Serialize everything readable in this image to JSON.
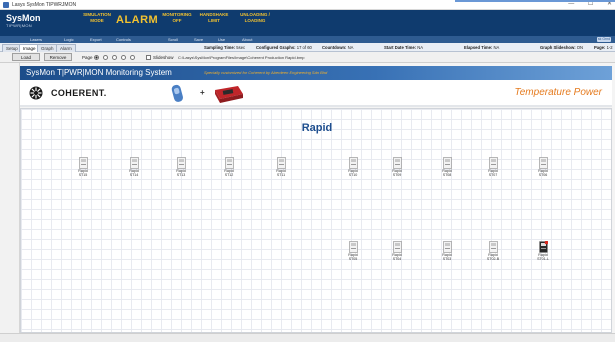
{
  "window": {
    "title": "Lasys SysMon TIPWRJMON",
    "controls": [
      "—",
      "☐",
      "✕"
    ]
  },
  "brand": {
    "name": "SysMon",
    "sub": "TIPWR|MON"
  },
  "ribbon": {
    "simulation": "SIMULATION MODE",
    "alarm": "ALARM",
    "monitoring": "MONITORING OFF",
    "handshake": "HANDSHAKE LIMIT",
    "unloading": "UNLOADING / LOADING"
  },
  "strip": {
    "items": [
      "Lasers",
      "Logic",
      "Export",
      "Controls",
      "Scroll",
      "Save",
      "Use",
      "About"
    ],
    "right": "sk Grnd"
  },
  "tabs": [
    "Setup",
    "Image",
    "Graph",
    "Alarm"
  ],
  "status": {
    "sampling": {
      "label": "Sampling Time:",
      "value": "5sec"
    },
    "graphs": {
      "label": "Configured Graphs:",
      "value": "17 of 60"
    },
    "countdown": {
      "label": "Countdown:",
      "value": "NA"
    },
    "start": {
      "label": "Start Date Time:",
      "value": "NA"
    },
    "elapsed": {
      "label": "Elapsed Time:",
      "value": "NA"
    },
    "slideshow": {
      "label": "Graph Slideshow:",
      "value": "ON"
    },
    "page": {
      "label": "Page:",
      "value": "1-2"
    }
  },
  "toolbar": {
    "load": "Load",
    "remove": "Remove",
    "page_label": "Page",
    "slideshow_label": "Slideshow",
    "path": "C:\\Lasys\\SysMon\\ProgramFiles\\Image\\Coherent Production Rapid.bmp"
  },
  "banner": {
    "title": "SysMon T|PWR|MON Monitoring System",
    "tagline": "Specially customized for Coherent by Aberdeen Engineering Sdn Bhd"
  },
  "logos": {
    "company": "COHERENT.",
    "plus": "+",
    "product_title": "Temperature Power"
  },
  "canvas": {
    "title": "Rapid",
    "devices": [
      {
        "label": "Rapid ST15",
        "alert": false
      },
      {
        "label": "Rapid ST14",
        "alert": false
      },
      {
        "label": "Rapid ST13",
        "alert": false
      },
      {
        "label": "Rapid ST12",
        "alert": false
      },
      {
        "label": "Rapid ST11",
        "alert": false
      },
      {
        "label": "Rapid ST10",
        "alert": false
      },
      {
        "label": "Rapid ST09",
        "alert": false
      },
      {
        "label": "Rapid ST08",
        "alert": false
      },
      {
        "label": "Rapid ST07",
        "alert": false
      },
      {
        "label": "Rapid ST06",
        "alert": false
      },
      {
        "label": "Rapid ST05",
        "alert": false
      },
      {
        "label": "Rapid ST04",
        "alert": false
      },
      {
        "label": "Rapid ST03",
        "alert": false
      },
      {
        "label": "Rapid ST02-B",
        "alert": false
      },
      {
        "label": "Rapid ST01-L",
        "alert": true
      }
    ]
  },
  "colors": {
    "ribbon": "#0f3b6e",
    "accent_yellow": "#f2c230",
    "banner_blue": "#2e63a6",
    "title_blue": "#1f4f8f",
    "orange": "#e57b1f",
    "alert_red": "#d9261c"
  }
}
